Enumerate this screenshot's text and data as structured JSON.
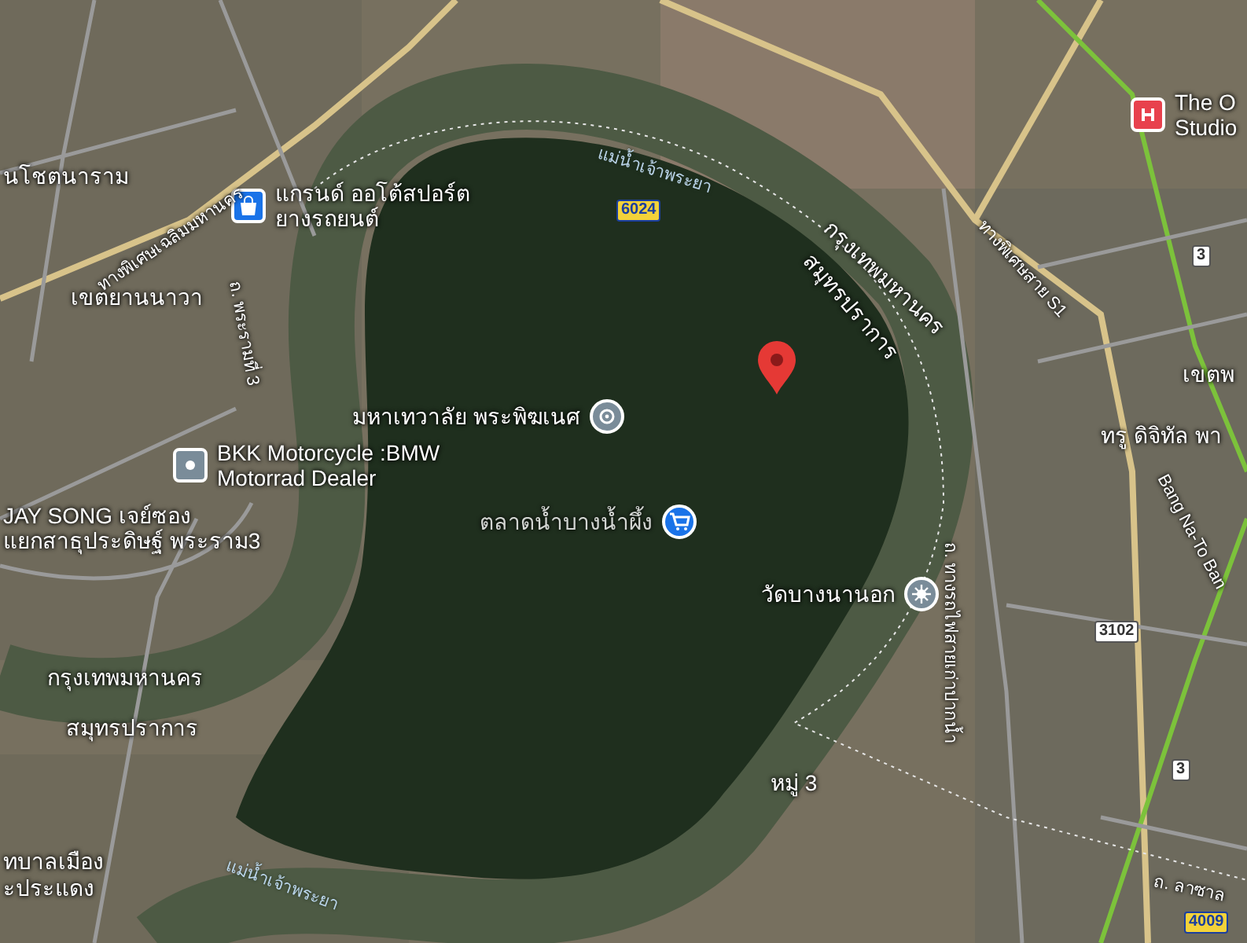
{
  "map": {
    "pois": [
      {
        "kind": "shopping",
        "lines": [
          "แกรนด์ ออโต้สปอร์ต",
          "ยางรถยนต์"
        ]
      },
      {
        "kind": "shrine",
        "lines": [
          "มหาเทวาลัย พระพิฆเนศ"
        ]
      },
      {
        "kind": "generic",
        "lines": [
          "BKK Motorcycle :BMW",
          "Motorrad Dealer"
        ]
      },
      {
        "kind": "market",
        "lines": [
          "ตลาดน้ำบางน้ำผึ้ง"
        ]
      },
      {
        "kind": "temple",
        "lines": [
          "วัดบางนานอก"
        ]
      },
      {
        "kind": "hospital",
        "lines": [
          "The O",
          "Studio"
        ]
      }
    ],
    "place_labels": [
      {
        "text": "นโชตนาราม"
      },
      {
        "text": "เขตยานนาวา"
      },
      {
        "text": "JAY SONG เจย์ซอง"
      },
      {
        "text": "แยกสาธุประดิษฐ์ พระราม3"
      },
      {
        "text": "กรุงเทพมหานคร"
      },
      {
        "text": "สมุทรปราการ"
      },
      {
        "text": "หมู่ 3"
      },
      {
        "text": "เขตพ"
      },
      {
        "text": "ทรู ดิจิทัล พา"
      },
      {
        "text": "ทบาลเมือง"
      },
      {
        "text": "ะประแดง"
      }
    ],
    "boundary_labels": [
      {
        "text": "กรุงเทพมหานคร"
      },
      {
        "text": "สมุทรปราการ"
      }
    ],
    "river_labels": [
      {
        "text": "แม่น้ำเจ้าพระยา"
      },
      {
        "text": "แม่น้ำเจ้าพระยา"
      }
    ],
    "road_labels": [
      {
        "text": "ทางพิเศษเฉลิมมหานคร"
      },
      {
        "text": "ถ. พระรามที่ 3"
      },
      {
        "text": "ทางพิเศษสาย S1"
      },
      {
        "text": "ถ. ทางรถไฟสายเก่าปากน้ำ"
      },
      {
        "text": "Bang Na-To Ban"
      },
      {
        "text": "ถ. ลาซาล"
      }
    ],
    "route_shields": [
      {
        "kind": "yellow",
        "text": "6024"
      },
      {
        "kind": "white",
        "text": "3"
      },
      {
        "kind": "white",
        "text": "3102"
      },
      {
        "kind": "white",
        "text": "3"
      },
      {
        "kind": "yellow",
        "text": "4009"
      }
    ]
  }
}
